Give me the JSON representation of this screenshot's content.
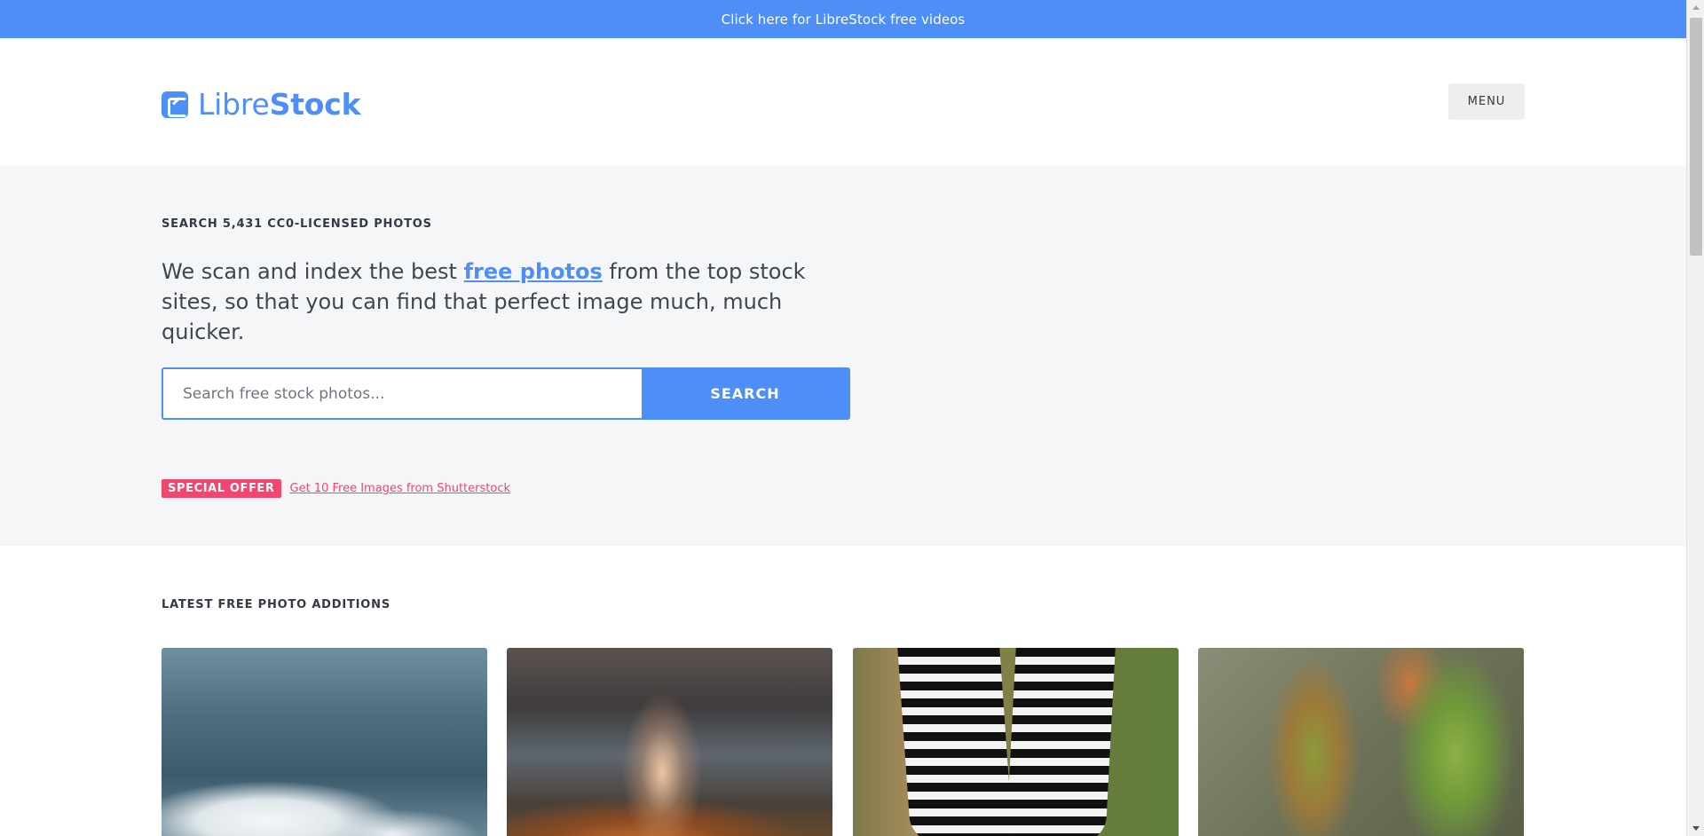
{
  "banner": {
    "text": "Click here for LibreStock free videos"
  },
  "header": {
    "logo_light": "Libre",
    "logo_bold": "Stock",
    "menu_label": "MENU"
  },
  "hero": {
    "kicker": "SEARCH 5,431 CC0-LICENSED PHOTOS",
    "intro_before": "We scan and index the best ",
    "intro_link": "free photos",
    "intro_after": " from the top stock sites, so that you can find that perfect image much, much quicker.",
    "search": {
      "placeholder": "Search free stock photos...",
      "value": "",
      "button_label": "SEARCH"
    },
    "offer": {
      "badge": "SPECIAL OFFER",
      "link": "Get 10 Free Images from Shutterstock"
    }
  },
  "latest": {
    "title": "LATEST FREE PHOTO ADDITIONS",
    "photos": [
      {
        "subject": "ocean wave"
      },
      {
        "subject": "autumn path"
      },
      {
        "subject": "striped socks"
      },
      {
        "subject": "green leaves"
      }
    ]
  },
  "colors": {
    "accent": "#4d8ef7",
    "offer": "#f0466f",
    "hero_bg": "#f5f6f8"
  }
}
